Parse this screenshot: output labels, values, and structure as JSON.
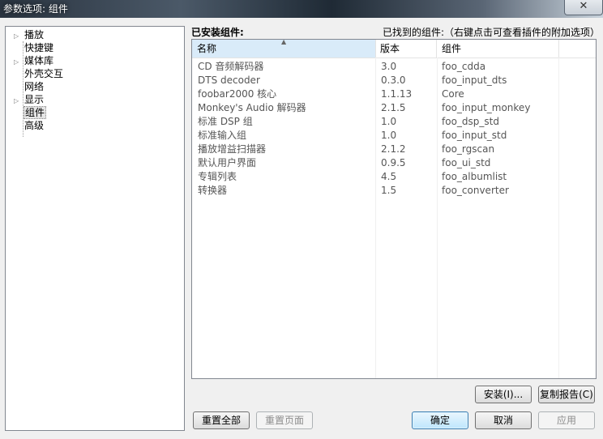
{
  "window": {
    "title": "参数选项: 组件",
    "close_glyph": "✕"
  },
  "tree": {
    "items": [
      {
        "label": "播放",
        "expandable": true
      },
      {
        "label": "快捷键",
        "expandable": false
      },
      {
        "label": "媒体库",
        "expandable": true
      },
      {
        "label": "外壳交互",
        "expandable": false
      },
      {
        "label": "网络",
        "expandable": false
      },
      {
        "label": "显示",
        "expandable": true
      },
      {
        "label": "组件",
        "expandable": false,
        "selected": true
      },
      {
        "label": "高级",
        "expandable": false
      }
    ]
  },
  "main": {
    "installed_label": "已安装组件:",
    "found_hint": "已找到的组件:（右键点击可查看插件的附加选项）",
    "columns": {
      "name": "名称",
      "version": "版本",
      "component": "组件"
    },
    "rows": [
      {
        "name": "CD 音频解码器",
        "version": "3.0",
        "component": "foo_cdda"
      },
      {
        "name": "DTS decoder",
        "version": "0.3.0",
        "component": "foo_input_dts"
      },
      {
        "name": "foobar2000 核心",
        "version": "1.1.13",
        "component": "Core"
      },
      {
        "name": "Monkey's Audio 解码器",
        "version": "2.1.5",
        "component": "foo_input_monkey"
      },
      {
        "name": "标准 DSP 组",
        "version": "1.0",
        "component": "foo_dsp_std"
      },
      {
        "name": "标准输入组",
        "version": "1.0",
        "component": "foo_input_std"
      },
      {
        "name": "播放增益扫描器",
        "version": "2.1.2",
        "component": "foo_rgscan"
      },
      {
        "name": "默认用户界面",
        "version": "0.9.5",
        "component": "foo_ui_std"
      },
      {
        "name": "专辑列表",
        "version": "4.5",
        "component": "foo_albumlist"
      },
      {
        "name": "转换器",
        "version": "1.5",
        "component": "foo_converter"
      }
    ]
  },
  "buttons": {
    "install": "安装(I)...",
    "copy_report": "复制报告(C)",
    "reset_all": "重置全部",
    "reset_page": "重置页面",
    "ok": "确定",
    "cancel": "取消",
    "apply": "应用"
  }
}
